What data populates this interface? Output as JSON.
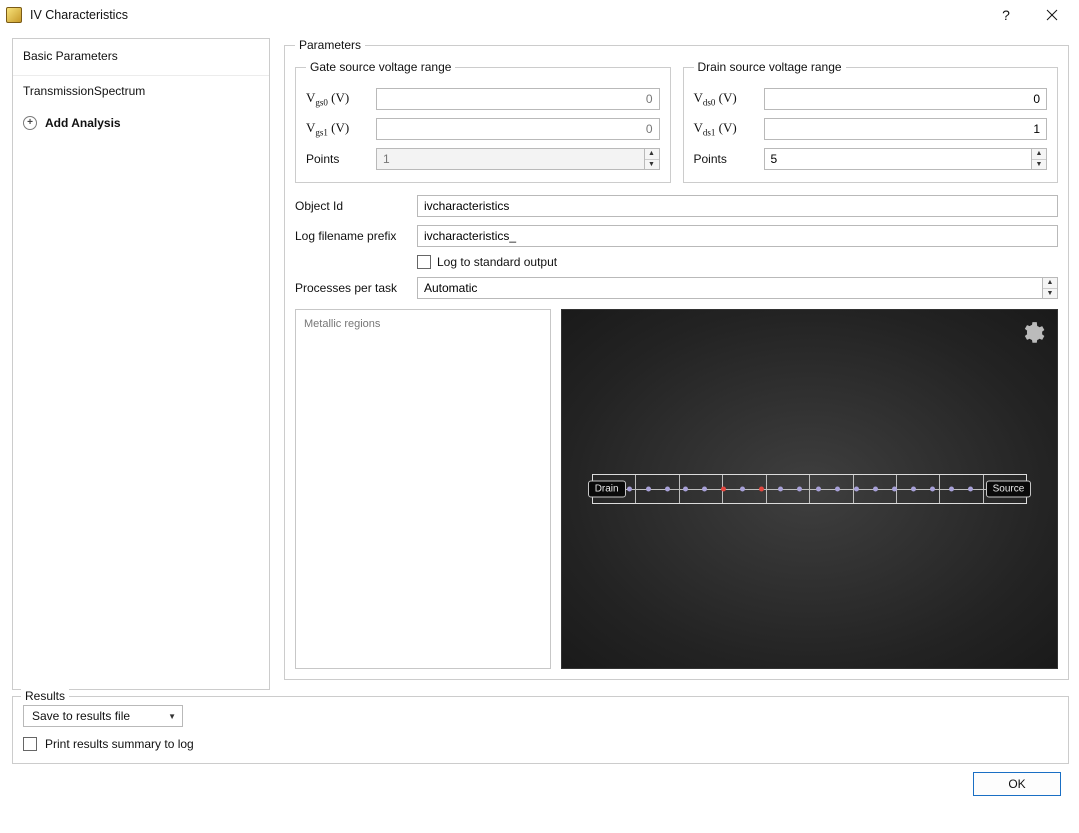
{
  "window": {
    "title": "IV Characteristics",
    "help_symbol": "?"
  },
  "sidebar": {
    "header": "Basic Parameters",
    "items": [
      "TransmissionSpectrum"
    ],
    "add_label": "Add Analysis"
  },
  "parameters": {
    "legend": "Parameters",
    "gate_group": {
      "legend": "Gate source voltage range",
      "v0_label": "V",
      "v0_sublabel": "gs0",
      "v0_unit": "(V)",
      "v0_value": "0",
      "v1_label": "V",
      "v1_sublabel": "gs1",
      "v1_unit": "(V)",
      "v1_value": "0",
      "points_label": "Points",
      "points_value": "1"
    },
    "drain_group": {
      "legend": "Drain source voltage range",
      "v0_label": "V",
      "v0_sublabel": "ds0",
      "v0_unit": "(V)",
      "v0_value": "0",
      "v1_label": "V",
      "v1_sublabel": "ds1",
      "v1_unit": "(V)",
      "v1_value": "1",
      "points_label": "Points",
      "points_value": "5"
    },
    "object_id_label": "Object Id",
    "object_id_value": "ivcharacteristics",
    "log_prefix_label": "Log filename prefix",
    "log_prefix_value": "ivcharacteristics_",
    "log_stdout_label": "Log to standard output",
    "processes_label": "Processes per task",
    "processes_value": "Automatic",
    "metallic_placeholder": "Metallic regions",
    "viewer": {
      "left_label": "Drain",
      "right_label": "Source"
    }
  },
  "results": {
    "legend": "Results",
    "save_dropdown": "Save to results file",
    "print_summary": "Print results summary to log"
  },
  "footer": {
    "ok": "OK"
  }
}
